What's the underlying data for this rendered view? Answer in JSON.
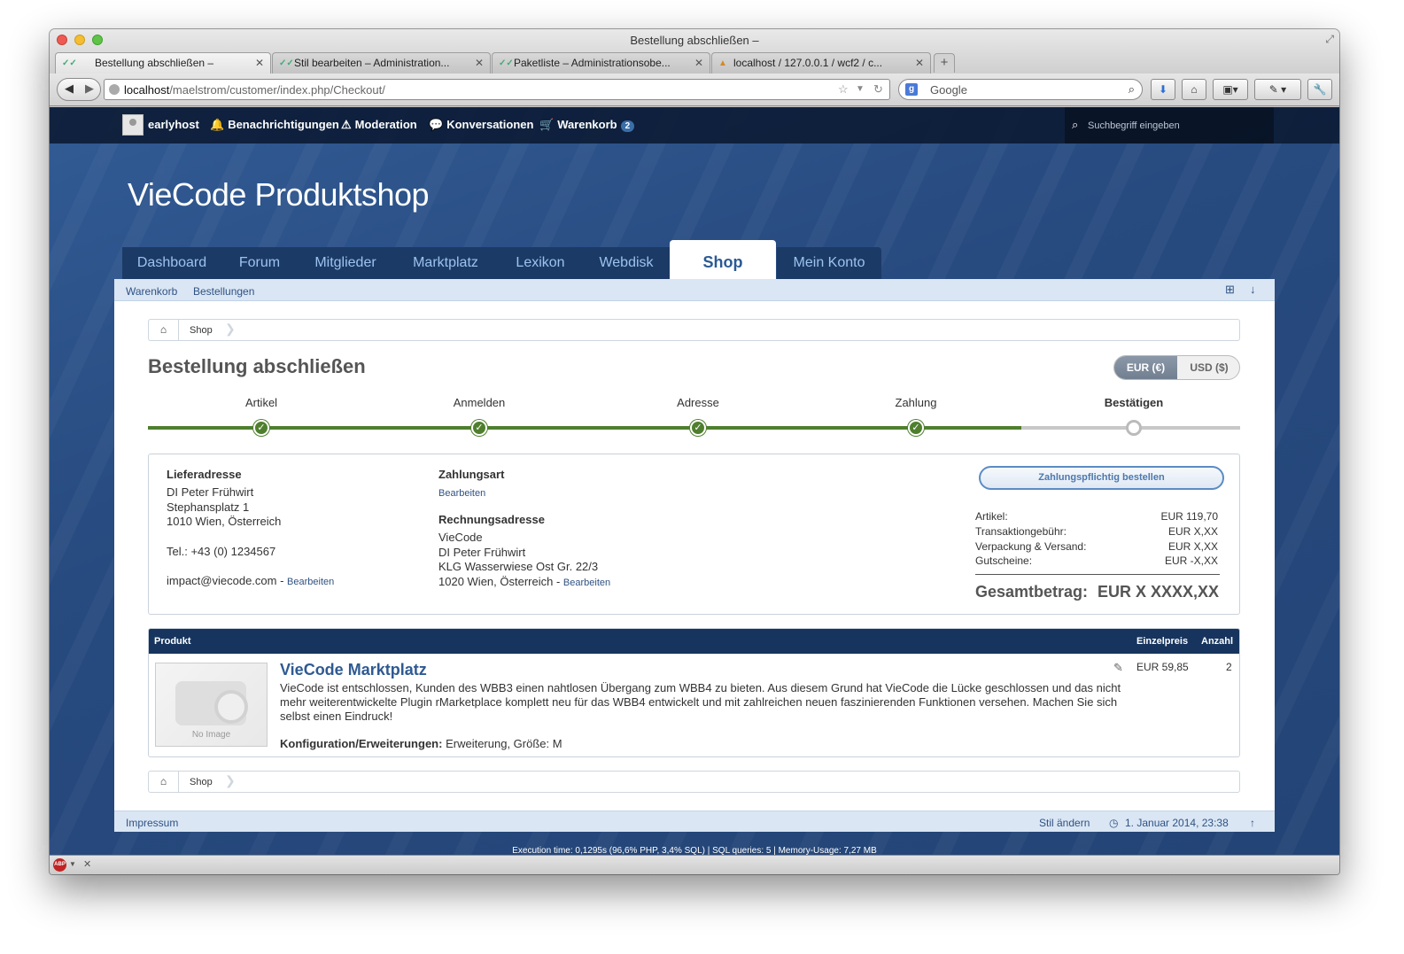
{
  "browser": {
    "window_title": "Bestellung abschließen –",
    "tabs": [
      {
        "label": "Bestellung abschließen –",
        "active": true
      },
      {
        "label": "Stil bearbeiten – Administration...",
        "active": false
      },
      {
        "label": "Paketliste – Administrationsobe...",
        "active": false
      },
      {
        "label": "localhost / 127.0.0.1 / wcf2 / c...",
        "active": false
      }
    ],
    "url_host": "localhost",
    "url_path": "/maelstrom/customer/index.php/Checkout/",
    "search_placeholder": "Google"
  },
  "userbar": {
    "username": "earlyhost",
    "notifications": "Benachrichtigungen",
    "moderation": "Moderation",
    "conversations": "Konversationen",
    "cart": "Warenkorb",
    "cart_count": "2",
    "search_placeholder": "Suchbegriff eingeben"
  },
  "site_title": "VieCode Produktshop",
  "main_nav": [
    "Dashboard",
    "Forum",
    "Mitglieder",
    "Marktplatz",
    "Lexikon",
    "Webdisk",
    "Shop",
    "Mein Konto"
  ],
  "sub_nav": [
    "Warenkorb",
    "Bestellungen"
  ],
  "breadcrumb": {
    "shop": "Shop"
  },
  "page": {
    "title": "Bestellung abschließen",
    "currency_eur": "EUR (€)",
    "currency_usd": "USD ($)"
  },
  "steps": [
    {
      "label": "Artikel",
      "done": true
    },
    {
      "label": "Anmelden",
      "done": true
    },
    {
      "label": "Adresse",
      "done": true
    },
    {
      "label": "Zahlung",
      "done": true
    },
    {
      "label": "Bestätigen",
      "done": false
    }
  ],
  "delivery": {
    "heading": "Lieferadresse",
    "name": "DI Peter Frühwirt",
    "street": "Stephansplatz 1",
    "city": "1010 Wien, Österreich",
    "phone": "Tel.: +43 (0) 1234567",
    "email": "impact@viecode.com",
    "edit": "Bearbeiten"
  },
  "payment": {
    "heading": "Zahlungsart",
    "edit": "Bearbeiten"
  },
  "billing": {
    "heading": "Rechnungsadresse",
    "company": "VieCode",
    "name": "DI Peter Frühwirt",
    "street": "KLG Wasserwiese Ost Gr. 22/3",
    "city": "1020 Wien, Österreich",
    "edit": "Bearbeiten"
  },
  "summary": {
    "order_button": "Zahlungspflichtig bestellen",
    "rows": [
      {
        "label": "Artikel:",
        "value": "EUR 119,70"
      },
      {
        "label": "Transaktiongebühr:",
        "value": "EUR X,XX"
      },
      {
        "label": "Verpackung & Versand:",
        "value": "EUR X,XX"
      },
      {
        "label": "Gutscheine:",
        "value": "EUR -X,XX"
      }
    ],
    "total_label": "Gesamtbetrag:",
    "total_value": "EUR X XXXX,XX"
  },
  "table": {
    "col_product": "Produkt",
    "col_price": "Einzelpreis",
    "col_qty": "Anzahl",
    "no_image": "No Image",
    "product_title": "VieCode Marktplatz",
    "product_desc": "VieCode ist entschlossen, Kunden des WBB3 einen nahtlosen Übergang zum WBB4 zu bieten. Aus diesem Grund hat VieCode die Lücke geschlossen und das nicht mehr weiterentwickelte Plugin rMarketplace komplett neu für das WBB4 entwickelt und mit zahlreichen neuen faszinierenden Funktionen versehen. Machen Sie sich selbst einen Eindruck!",
    "config_label": "Konfiguration/Erweiterungen:",
    "config_value": "Erweiterung, Größe: M",
    "price": "EUR 59,85",
    "qty": "2"
  },
  "footer": {
    "impressum": "Impressum",
    "style": "Stil ändern",
    "datetime": "1. Januar 2014, 23:38"
  },
  "exec_info": "Execution time: 0,1295s (96,6% PHP, 3,4% SQL) | SQL queries: 5 | Memory-Usage: 7,27 MB"
}
